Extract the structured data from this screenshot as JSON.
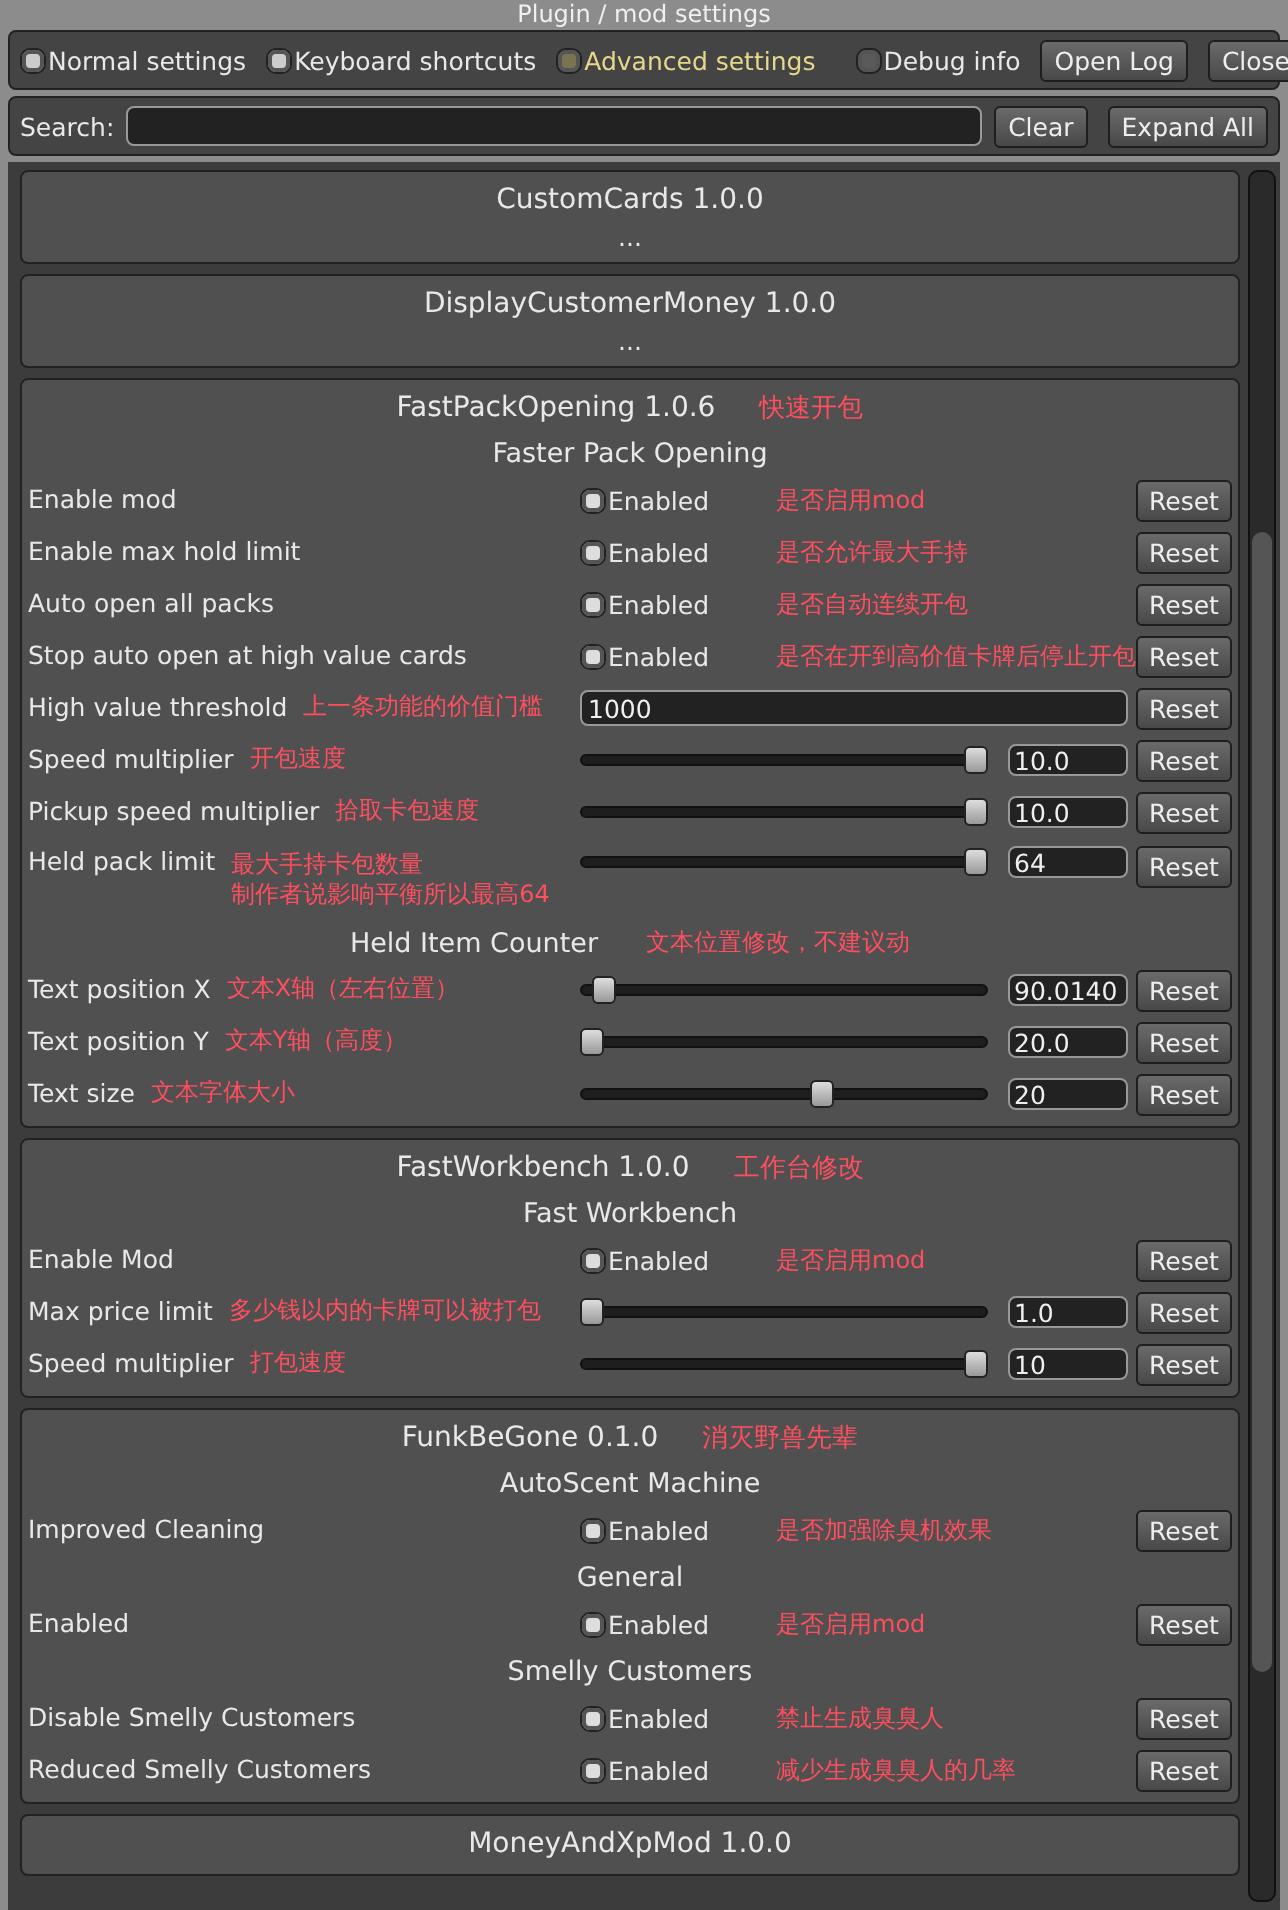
{
  "window": {
    "title": "Plugin / mod settings"
  },
  "tabs": [
    {
      "label": "Normal settings",
      "selected": false
    },
    {
      "label": "Keyboard shortcuts",
      "selected": false
    },
    {
      "label": "Advanced settings",
      "selected": true
    }
  ],
  "debug": {
    "label": "Debug info",
    "checked": false
  },
  "top_buttons": [
    "Open Log",
    "Close"
  ],
  "search": {
    "label": "Search:"
  },
  "search_buttons": [
    "Clear",
    "Expand All"
  ],
  "sections": [
    {
      "title": "CustomCards 1.0.0",
      "summary": "..."
    },
    {
      "title": "DisplayCustomerMoney 1.0.0",
      "summary": "..."
    },
    {
      "title": "FastPackOpening 1.0.6",
      "note": "快速开包",
      "items": [
        {
          "kind": "group",
          "label": "Faster Pack Opening"
        },
        {
          "kind": "toggle",
          "label": "Enable mod",
          "checked": true,
          "value": "Enabled",
          "note": "是否启用mod",
          "reset": "Reset"
        },
        {
          "kind": "toggle",
          "label": "Enable max hold limit",
          "checked": true,
          "value": "Enabled",
          "note": "是否允许最大手持",
          "reset": "Reset"
        },
        {
          "kind": "toggle",
          "label": "Auto open all packs",
          "checked": true,
          "value": "Enabled",
          "note": "是否自动连续开包",
          "reset": "Reset"
        },
        {
          "kind": "toggle",
          "label": "Stop auto open at high value cards",
          "checked": true,
          "value": "Enabled",
          "note": "是否在开到高价值卡牌后停止开包",
          "reset": "Reset"
        },
        {
          "kind": "text",
          "label": "High value threshold",
          "value": "1000",
          "note": "上一条功能的价值门槛",
          "reset": "Reset"
        },
        {
          "kind": "slider",
          "label": "Speed multiplier",
          "level": 1.0,
          "value": "10.0",
          "note": "开包速度",
          "reset": "Reset"
        },
        {
          "kind": "slider",
          "label": "Pickup speed multiplier",
          "level": 1.0,
          "value": "10.0",
          "note": "拾取卡包速度",
          "reset": "Reset"
        },
        {
          "kind": "slider",
          "label": "Held pack limit",
          "level": 1.0,
          "value": "64",
          "notes": [
            "最大手持卡包数量",
            "制作者说影响平衡所以最高64"
          ],
          "reset": "Reset"
        },
        {
          "kind": "group",
          "label": "Held Item Counter",
          "note": "文本位置修改，不建议动"
        },
        {
          "kind": "slider",
          "label": "Text position X",
          "level": 0.03,
          "value": "90.0140",
          "note": "文本X轴（左右位置）",
          "reset": "Reset"
        },
        {
          "kind": "slider",
          "label": "Text position Y",
          "level": 0.0,
          "value": "20.0",
          "note": "文本Y轴（高度）",
          "reset": "Reset"
        },
        {
          "kind": "slider",
          "label": "Text size",
          "level": 0.6,
          "value": "20",
          "note": "文本字体大小",
          "reset": "Reset"
        }
      ]
    },
    {
      "title": "FastWorkbench 1.0.0",
      "note": "工作台修改",
      "items": [
        {
          "kind": "group",
          "label": "Fast Workbench"
        },
        {
          "kind": "toggle",
          "label": "Enable Mod",
          "checked": true,
          "value": "Enabled",
          "note": "是否启用mod",
          "reset": "Reset"
        },
        {
          "kind": "slider",
          "label": "Max price limit",
          "level": 0.0,
          "value": "1.0",
          "note": "多少钱以内的卡牌可以被打包",
          "reset": "Reset"
        },
        {
          "kind": "slider",
          "label": "Speed multiplier",
          "level": 1.0,
          "value": "10",
          "note": "打包速度",
          "reset": "Reset"
        }
      ]
    },
    {
      "title": "FunkBeGone 0.1.0",
      "note": "消灭野兽先辈",
      "items": [
        {
          "kind": "group",
          "label": "AutoScent Machine"
        },
        {
          "kind": "toggle",
          "label": "Improved Cleaning",
          "checked": true,
          "value": "Enabled",
          "note": "是否加强除臭机效果",
          "reset": "Reset"
        },
        {
          "kind": "group",
          "label": "General"
        },
        {
          "kind": "toggle",
          "label": "Enabled",
          "checked": true,
          "value": "Enabled",
          "note": "是否启用mod",
          "reset": "Reset"
        },
        {
          "kind": "group",
          "label": "Smelly Customers"
        },
        {
          "kind": "toggle",
          "label": "Disable Smelly Customers",
          "checked": true,
          "value": "Enabled",
          "note": "禁止生成臭臭人",
          "reset": "Reset"
        },
        {
          "kind": "toggle",
          "label": "Reduced Smelly Customers",
          "checked": true,
          "value": "Enabled",
          "note": "减少生成臭臭人的几率",
          "reset": "Reset"
        }
      ]
    },
    {
      "title": "MoneyAndXpMod 1.0.0"
    }
  ]
}
